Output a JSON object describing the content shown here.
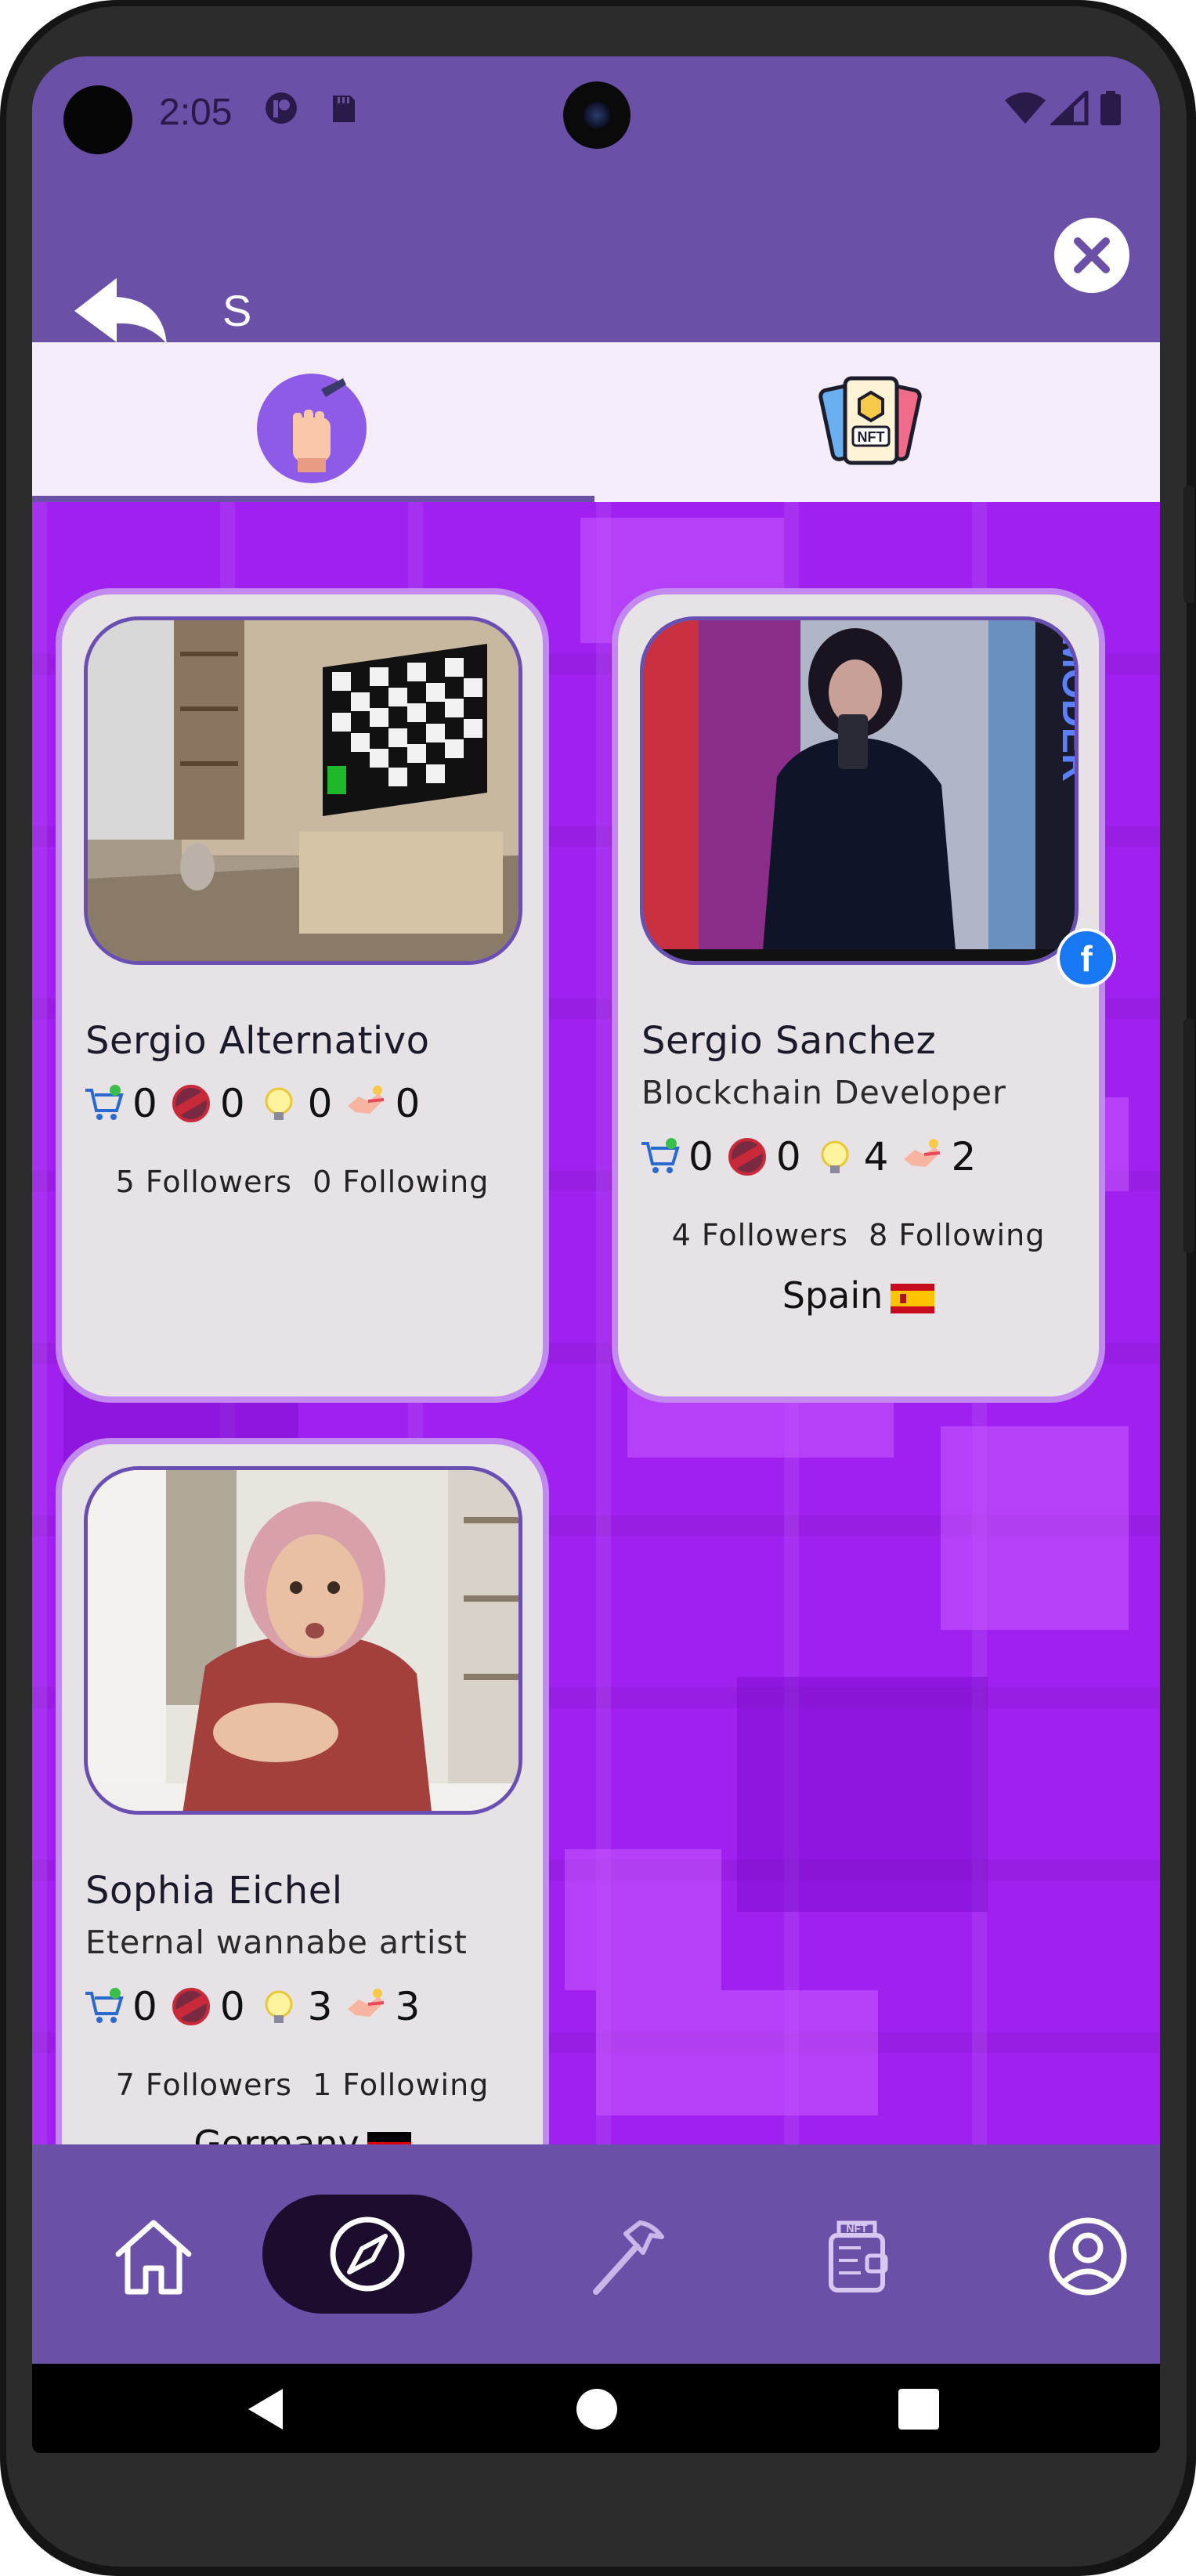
{
  "status_bar": {
    "time": "2:05",
    "icons": [
      "notification-app-icon",
      "sd-card-icon",
      "wifi-icon",
      "signal-icon",
      "battery-icon"
    ]
  },
  "search": {
    "query": "S",
    "back_icon": "back-arrow-icon",
    "clear_icon": "close-icon"
  },
  "tabs": [
    {
      "id": "artists",
      "icon": "artist-fist-brush-icon",
      "selected": true
    },
    {
      "id": "nfts",
      "icon": "nft-cards-icon",
      "selected": false
    }
  ],
  "stat_icons": [
    "cart-icon",
    "sold-stamp-icon",
    "idea-bulb-icon",
    "handshake-icon"
  ],
  "cards": [
    {
      "name": "Sergio Alternativo",
      "bio": "",
      "stats": [
        "0",
        "0",
        "0",
        "0"
      ],
      "followers": "5 Followers",
      "following": "0 Following",
      "country": "",
      "flag": "",
      "photo": "room-with-checkerboard-tv-photo",
      "facebook_badge": ""
    },
    {
      "name": "Sergio Sanchez",
      "bio": "Blockchain Developer",
      "stats": [
        "0",
        "0",
        "4",
        "2"
      ],
      "followers": "4 Followers",
      "following": "8 Following",
      "country": "Spain",
      "flag": "spain-flag",
      "photo": "woman-in-leather-jacket-photo",
      "facebook_badge": "f"
    },
    {
      "name": "Sophia Eichel",
      "bio": "Eternal wannabe artist",
      "stats": [
        "0",
        "0",
        "3",
        "3"
      ],
      "followers": "7 Followers",
      "following": "1 Following",
      "country": "Germany",
      "flag": "germany-flag",
      "photo": "surprised-woman-photo",
      "facebook_badge": ""
    }
  ],
  "bottom_nav": [
    {
      "id": "home",
      "icon": "home-icon",
      "active": false
    },
    {
      "id": "explore",
      "icon": "compass-icon",
      "active": true
    },
    {
      "id": "create",
      "icon": "hammer-icon",
      "active": false
    },
    {
      "id": "wallet",
      "icon": "nft-wallet-icon",
      "active": false
    },
    {
      "id": "profile",
      "icon": "user-profile-icon",
      "active": false
    }
  ],
  "colors": {
    "primary": "#6b50a8",
    "background": "#a020f0",
    "card": "#e6e2e6",
    "card_border": "#c28af0",
    "tab_bar": "#f5ecfa"
  }
}
